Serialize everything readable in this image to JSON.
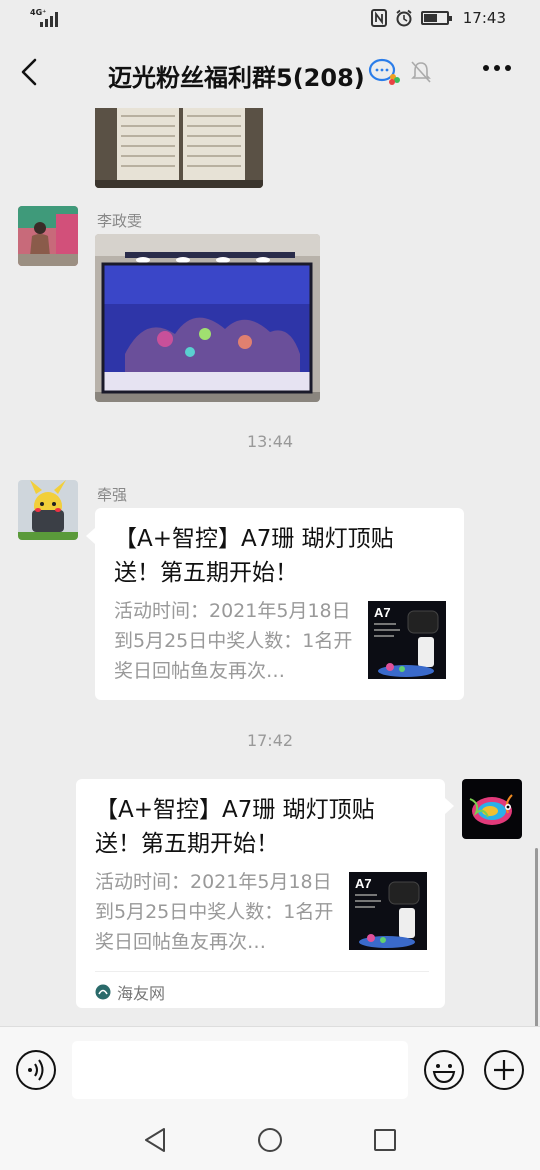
{
  "status_bar": {
    "network": "4G⁺",
    "time": "17:43"
  },
  "header": {
    "title": "迈光粉丝福利群5(208)"
  },
  "messages": [
    {
      "sender": "李政雯",
      "kind": "image",
      "image": "aquarium-photo"
    },
    {
      "kind": "timestamp",
      "text": "13:44"
    },
    {
      "sender": "牵强",
      "kind": "link-card",
      "title": "【A+智控】A7珊 瑚灯顶贴送！第五期开始！",
      "desc": "活动时间：2021年5月18日到5月25日中奖人数：1名开奖日回帖鱼友再次…",
      "thumb_label": "A7"
    },
    {
      "kind": "timestamp",
      "text": "17:42"
    },
    {
      "sender": "self",
      "kind": "link-card",
      "title": "【A+智控】A7珊 瑚灯顶贴送！第五期开始！",
      "desc": "活动时间：2021年5月18日到5月25日中奖人数：1名开奖日回帖鱼友再次…",
      "thumb_label": "A7",
      "source": "海友网"
    }
  ],
  "colors": {
    "background": "#ededed",
    "bubble": "#ffffff",
    "muted_text": "#999999",
    "accent_blue": "#2b7de9"
  }
}
